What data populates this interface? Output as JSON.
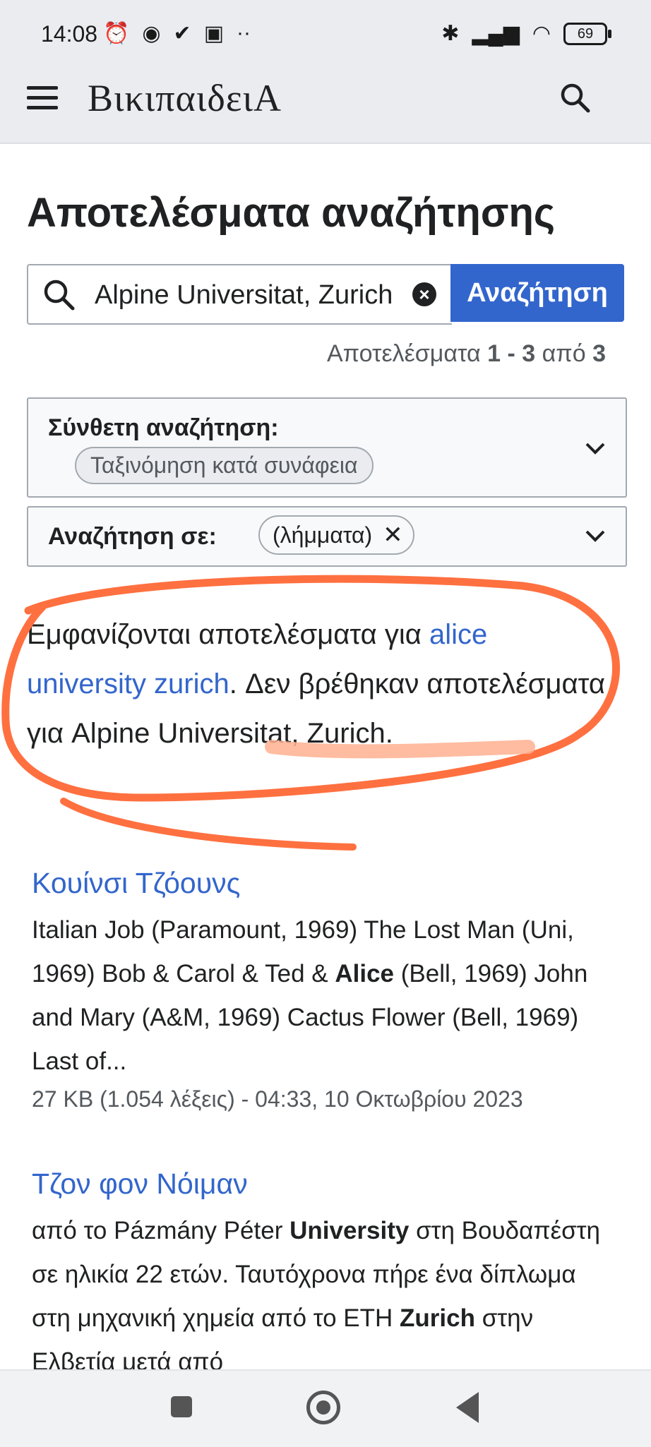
{
  "status_bar": {
    "time": "14:08",
    "left_icons": [
      "alarm-icon",
      "chrome-icon",
      "check-icon",
      "briefcase-icon",
      "more-dots-icon"
    ],
    "battery": "69"
  },
  "header": {
    "logo": "ΒικιπαιδειΑ"
  },
  "page_title": "Αποτελέσματα αναζήτησης",
  "search": {
    "value": "Alpine Universitat, Zurich",
    "button_label": "Αναζήτηση"
  },
  "results_count": {
    "prefix": "Αποτελέσματα",
    "range": "1 - 3",
    "of": "από",
    "total": "3"
  },
  "advanced": {
    "label": "Σύνθετη αναζήτηση:",
    "sort_chip": "Ταξινόμηση κατά συνάφεια"
  },
  "namespace": {
    "label": "Αναζήτηση σε:",
    "chip": "(λήμματα)"
  },
  "message": {
    "part1": "Εμφανίζονται αποτελέσματα για ",
    "link": "alice university zurich",
    "part2": ". Δεν βρέθηκαν αποτελέσματα για ",
    "query": "Alpine Universitat, Zurich",
    "part3": "."
  },
  "annotation_color": "#ff7040",
  "results": [
    {
      "title": "Κουίνσι Τζόουνς",
      "snippet_a": "Italian Job (Paramount, 1969) The Lost Man (Uni, 1969) Bob & Carol & Ted & ",
      "snippet_bold": "Alice",
      "snippet_b": " (Bell, 1969) John and Mary (A&M, 1969) Cactus Flower (Bell, 1969) Last of...",
      "meta": "27 KB (1.054 λέξεις) - 04:33, 10 Οκτωβρίου 2023"
    },
    {
      "title": "Τζον φον Νόιμαν",
      "snippet_a": "από το Pázmány Péter ",
      "snippet_bold": "University",
      "snippet_b": " στη Βουδαπέστη σε ηλικία 22 ετών. Ταυτόχρονα πήρε ένα δίπλωμα στη μηχανική χημεία από το ETH ",
      "snippet_bold2": "Zurich",
      "snippet_c": " στην Ελβετία μετά από"
    }
  ]
}
